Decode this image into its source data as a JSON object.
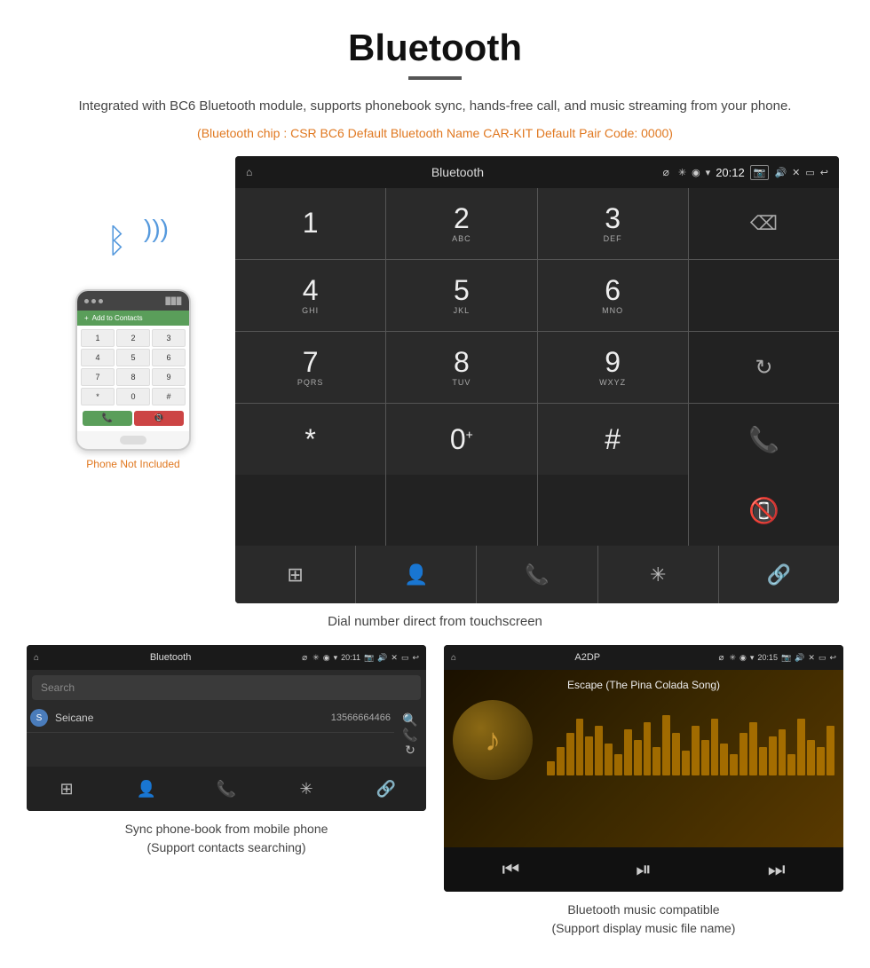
{
  "page": {
    "title": "Bluetooth",
    "subtitle": "Integrated with BC6 Bluetooth module, supports phonebook sync, hands-free call, and music streaming from your phone.",
    "specs": "(Bluetooth chip : CSR BC6    Default Bluetooth Name CAR-KIT    Default Pair Code: 0000)",
    "dial_caption": "Dial number direct from touchscreen",
    "phone_not_included": "Phone Not Included",
    "phonebook_caption": "Sync phone-book from mobile phone\n(Support contacts searching)",
    "music_caption": "Bluetooth music compatible\n(Support display music file name)"
  },
  "status_bar": {
    "title": "Bluetooth",
    "time": "20:12",
    "usb_icon": "⌀",
    "home_icon": "⌂"
  },
  "dialpad": {
    "keys": [
      {
        "num": "1",
        "sub": ""
      },
      {
        "num": "2",
        "sub": "ABC"
      },
      {
        "num": "3",
        "sub": "DEF"
      },
      {
        "num": "",
        "sub": "",
        "type": "backspace"
      },
      {
        "num": "4",
        "sub": "GHI"
      },
      {
        "num": "5",
        "sub": "JKL"
      },
      {
        "num": "6",
        "sub": "MNO"
      },
      {
        "num": "",
        "sub": "",
        "type": "empty"
      },
      {
        "num": "7",
        "sub": "PQRS"
      },
      {
        "num": "8",
        "sub": "TUV"
      },
      {
        "num": "9",
        "sub": "WXYZ"
      },
      {
        "num": "",
        "sub": "",
        "type": "refresh"
      },
      {
        "num": "*",
        "sub": ""
      },
      {
        "num": "0",
        "sub": "+"
      },
      {
        "num": "#",
        "sub": ""
      },
      {
        "num": "",
        "sub": "",
        "type": "call_green"
      },
      {
        "num": "",
        "sub": "",
        "type": "empty_row5"
      },
      {
        "num": "",
        "sub": "",
        "type": "empty_row5"
      },
      {
        "num": "",
        "sub": "",
        "type": "empty_row5"
      },
      {
        "num": "",
        "sub": "",
        "type": "call_red"
      }
    ],
    "toolbar": [
      "grid",
      "person",
      "phone",
      "bluetooth",
      "link"
    ]
  },
  "phonebook": {
    "mini_status_title": "Bluetooth",
    "mini_status_time": "20:11",
    "search_placeholder": "Search",
    "contacts": [
      {
        "letter": "S",
        "name": "Seicane",
        "number": "13566664466"
      }
    ],
    "caption_line1": "Sync phone-book from mobile phone",
    "caption_line2": "(Support contacts searching)"
  },
  "music": {
    "mini_status_title": "A2DP",
    "mini_status_time": "20:15",
    "song_title": "Escape (The Pina Colada Song)",
    "eq_bars": [
      20,
      40,
      60,
      80,
      55,
      70,
      45,
      30,
      65,
      50,
      75,
      40,
      85,
      60,
      35,
      70,
      50,
      80,
      45,
      30,
      60,
      75,
      40,
      55,
      65,
      30,
      80,
      50,
      40,
      70
    ],
    "caption_line1": "Bluetooth music compatible",
    "caption_line2": "(Support display music file name)"
  }
}
